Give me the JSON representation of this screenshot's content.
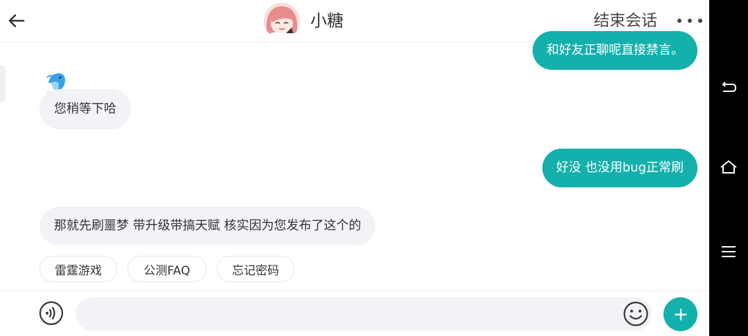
{
  "header": {
    "title": "小糖",
    "end_chat_label": "结束会话"
  },
  "messages": [
    {
      "side": "out",
      "text": "和好友正聊呢直接禁言。"
    },
    {
      "side": "in",
      "text": "您稍等下哈"
    },
    {
      "side": "out",
      "text": "好没 也没用bug正常刷"
    },
    {
      "side": "in",
      "text": "那就先刷噩梦 带升级带搞天赋 核实因为您发布了这个的"
    }
  ],
  "quick_replies": [
    "雷霆游戏",
    "公测FAQ",
    "忘记密码"
  ],
  "input": {
    "value": "",
    "placeholder": ""
  },
  "icons": {
    "back": "arrow-left-icon",
    "more": "more-dots-icon",
    "voice": "voice-icon",
    "emoji": "emoji-icon",
    "plus": "plus-icon",
    "bot": "dolphin-bot-icon",
    "nav_back": "android-back-icon",
    "nav_home": "android-home-icon",
    "nav_menu": "android-menu-icon"
  },
  "colors": {
    "accent": "#14b0ac",
    "bubble_in": "#f1f3f6"
  }
}
